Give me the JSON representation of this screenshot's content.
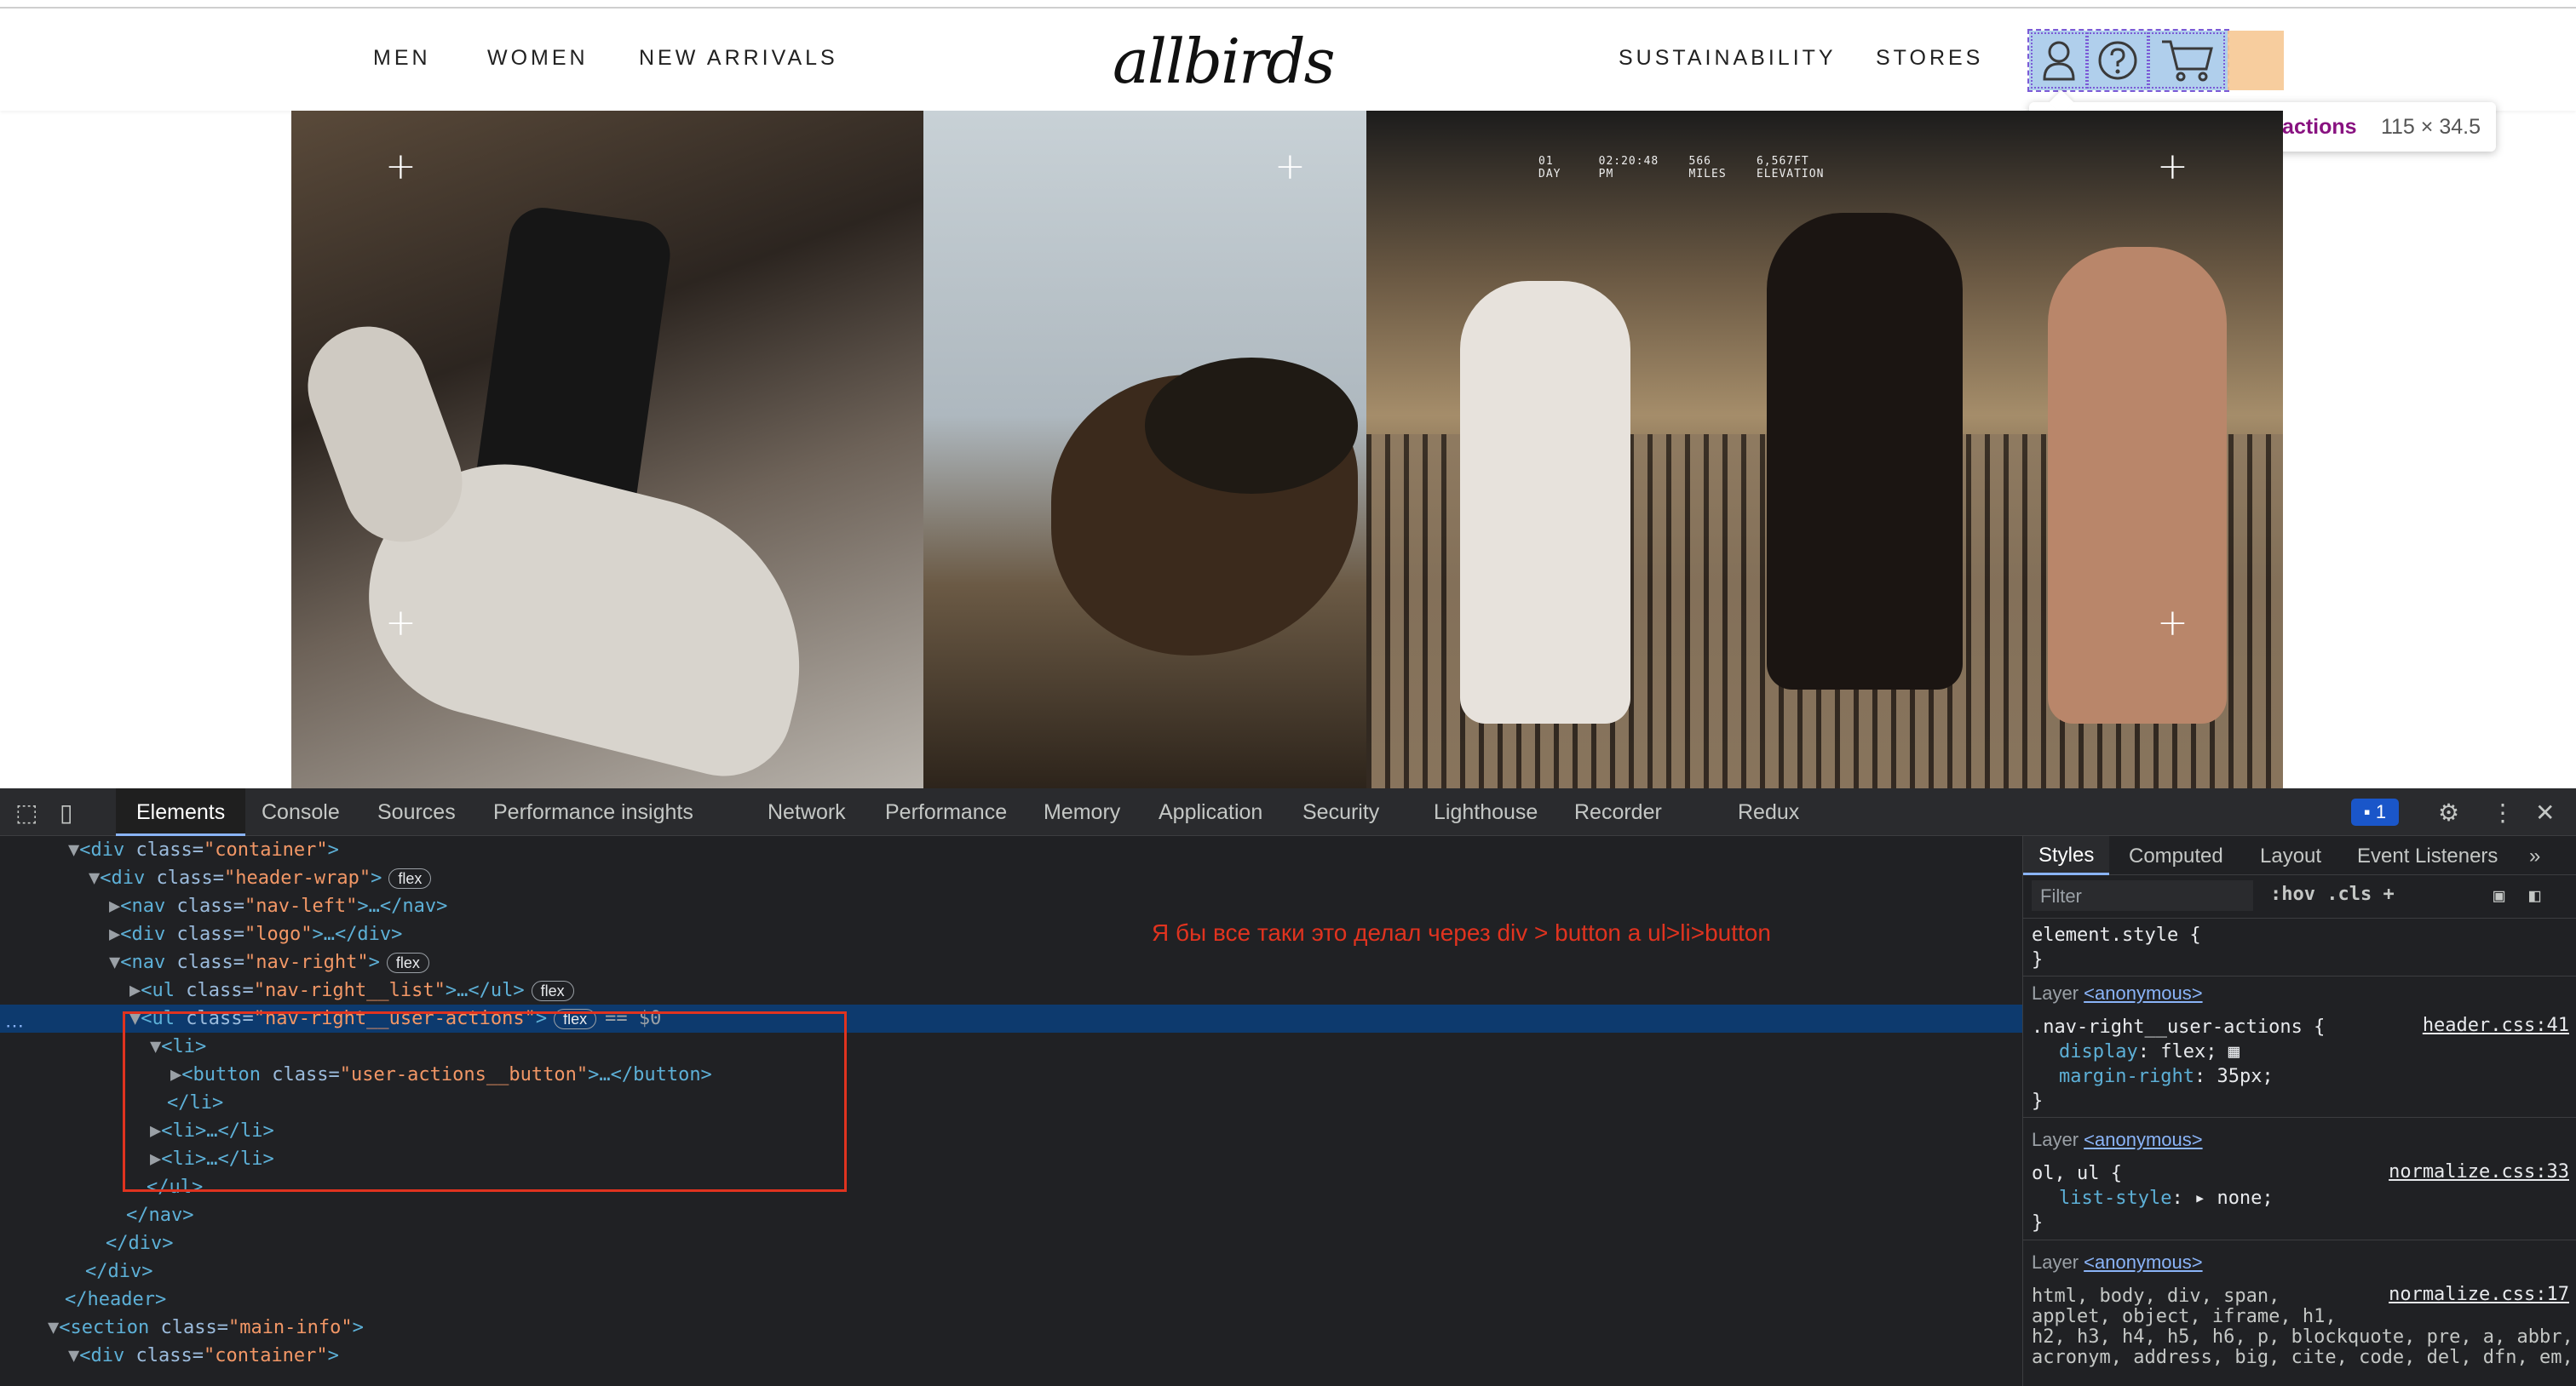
{
  "site": {
    "nav_left": [
      "MEN",
      "WOMEN",
      "NEW ARRIVALS"
    ],
    "logo": "allbirds",
    "nav_right": [
      "SUSTAINABILITY",
      "STORES"
    ],
    "user_action_icons": [
      "account-icon",
      "help-icon",
      "cart-icon"
    ],
    "tooltip": {
      "selector": "ul.nav-right__user-actions",
      "size": "115 × 34.5"
    },
    "hero_overlay": "01      02:20:48    566      6,567FT\nDAY     PM          MILES    ELEVATION"
  },
  "devtools": {
    "tabs": [
      "Elements",
      "Console",
      "Sources",
      "Performance insights",
      "Network",
      "Performance",
      "Memory",
      "Application",
      "Security",
      "Lighthouse",
      "Recorder",
      "Redux"
    ],
    "issues_count": "1",
    "comment": "Я бы все таки это делал через div > button а  ul>li>button",
    "dom": {
      "l1": {
        "open": "<div ",
        "attr": "class=",
        "val": "\"container\"",
        "close": ">"
      },
      "l2": {
        "open": "<div ",
        "attr": "class=",
        "val": "\"header-wrap\"",
        "close": ">",
        "badge": "flex"
      },
      "l3": {
        "open": "<nav ",
        "attr": "class=",
        "val": "\"nav-left\"",
        "close": ">…</nav>"
      },
      "l4": {
        "open": "<div ",
        "attr": "class=",
        "val": "\"logo\"",
        "close": ">…</div>"
      },
      "l5": {
        "open": "<nav ",
        "attr": "class=",
        "val": "\"nav-right\"",
        "close": ">",
        "badge": "flex"
      },
      "l6": {
        "open": "<ul ",
        "attr": "class=",
        "val": "\"nav-right__list\"",
        "close": ">…</ul>",
        "badge": "flex"
      },
      "l7": {
        "open": "<ul ",
        "attr": "class=",
        "val": "\"nav-right__user-actions\"",
        "close": ">",
        "badge": "flex",
        "eq": "== $0"
      },
      "l8": "<li>",
      "l9": {
        "open": "<button ",
        "attr": "class=",
        "val": "\"user-actions__button\"",
        "close": ">…</button>"
      },
      "l10": "</li>",
      "l11": "<li>…</li>",
      "l12": "<li>…</li>",
      "l13": "</ul>",
      "l14": "</nav>",
      "l15": "</div>",
      "l16": "</div>",
      "l17": "</header>",
      "l18": {
        "open": "<section ",
        "attr": "class=",
        "val": "\"main-info\"",
        "close": ">"
      },
      "l19": {
        "open": "<div ",
        "attr": "class=",
        "val": "\"container\"",
        "close": ">"
      }
    },
    "styles": {
      "tabs": [
        "Styles",
        "Computed",
        "Layout",
        "Event Listeners"
      ],
      "filter_placeholder": "Filter",
      "buttons": ":hov  .cls  +",
      "element_style": "element.style {",
      "close_brace": "}",
      "layer_label": "Layer ",
      "layer_name": "<anonymous>",
      "rule1": {
        "selector": ".nav-right__user-actions {",
        "src": "header.css:41",
        "p1": "display",
        "v1": "flex;",
        "p2": "margin-right",
        "v2": "35px;"
      },
      "rule2": {
        "selector": "ol, ul {",
        "src": "normalize.css:33",
        "p1": "list-style",
        "v1": "▸ none;"
      },
      "rule3": {
        "src": "normalize.css:17",
        "l1": "html, body, div, span,",
        "l2": "applet, object, iframe, h1,",
        "l3": "h2, h3, h4, h5, h6, p, blockquote, pre, a, abbr,",
        "l4": "acronym, address, big, cite, code, del, dfn, em,"
      }
    }
  },
  "colors": {
    "selection": "#0d3a6e",
    "annotation": "#e0331f",
    "overlay": "#6fa8dc",
    "margin": "#f6c894"
  }
}
